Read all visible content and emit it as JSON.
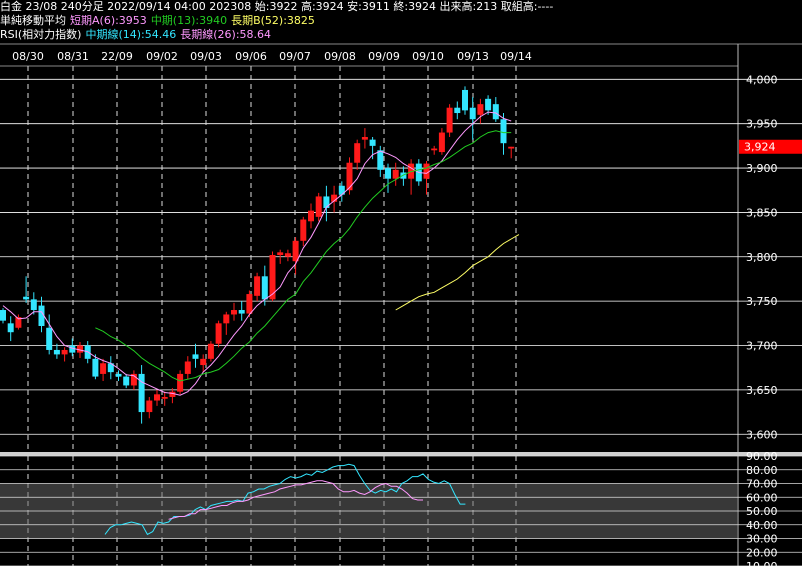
{
  "header": {
    "line1": "白金 23/08 240分足 2022/09/14 04:00 202308 始:3922 高:3924 安:3911 終:3924 出来高:213 取組高:----",
    "line2": {
      "label": "単純移動平均",
      "short": "短期A(6):3953",
      "mid": "中期(13):3940",
      "long": "長期B(52):3825"
    },
    "line3": {
      "label": "RSI(相対力指数)",
      "mid": "中期線(14):54.46",
      "long": "長期線(26):58.64"
    }
  },
  "colors": {
    "up": "#ff1a1a",
    "down": "#33e6ff",
    "ma_short": "#ff99ff",
    "ma_mid": "#22cc22",
    "ma_long": "#ffff66",
    "rsi_mid": "#33e6ff",
    "rsi_long": "#ff99ff",
    "grid": "#ffffff",
    "price_tag_bg": "#ff0000"
  },
  "last_price_label": "3,924",
  "chart_data": {
    "type": "candlestick",
    "date_labels": [
      "08/30",
      "08/31",
      "22/09",
      "09/02",
      "09/03",
      "09/06",
      "09/07",
      "09/08",
      "09/09",
      "09/10",
      "09/13",
      "09/14"
    ],
    "price_axis": {
      "ticks": [
        "4,000",
        "3,950",
        "3,900",
        "3,850",
        "3,800",
        "3,750",
        "3,700",
        "3,650",
        "3,600"
      ],
      "range": [
        3580,
        4015
      ]
    },
    "rsi_axis": {
      "ticks": [
        "90.00",
        "80.00",
        "70.00",
        "60.00",
        "50.00",
        "40.00",
        "30.00",
        "20.00",
        "10.00"
      ],
      "range": [
        10,
        90
      ]
    },
    "candles": [
      [
        3740,
        3742,
        3725,
        3728
      ],
      [
        3725,
        3733,
        3705,
        3715
      ],
      [
        3720,
        3735,
        3718,
        3732
      ],
      [
        3755,
        3778,
        3748,
        3752
      ],
      [
        3752,
        3760,
        3735,
        3740
      ],
      [
        3745,
        3755,
        3715,
        3722
      ],
      [
        3720,
        3735,
        3690,
        3695
      ],
      [
        3695,
        3702,
        3685,
        3690
      ],
      [
        3690,
        3698,
        3682,
        3695
      ],
      [
        3700,
        3708,
        3688,
        3692
      ],
      [
        3692,
        3704,
        3686,
        3700
      ],
      [
        3700,
        3705,
        3680,
        3685
      ],
      [
        3685,
        3690,
        3662,
        3665
      ],
      [
        3668,
        3685,
        3660,
        3680
      ],
      [
        3680,
        3688,
        3662,
        3670
      ],
      [
        3668,
        3672,
        3660,
        3665
      ],
      [
        3665,
        3668,
        3652,
        3655
      ],
      [
        3655,
        3672,
        3650,
        3668
      ],
      [
        3668,
        3678,
        3612,
        3625
      ],
      [
        3625,
        3642,
        3618,
        3638
      ],
      [
        3638,
        3650,
        3632,
        3645
      ],
      [
        3640,
        3648,
        3632,
        3642
      ],
      [
        3642,
        3652,
        3635,
        3648
      ],
      [
        3648,
        3672,
        3645,
        3668
      ],
      [
        3668,
        3688,
        3662,
        3682
      ],
      [
        3690,
        3702,
        3675,
        3685
      ],
      [
        3678,
        3690,
        3670,
        3685
      ],
      [
        3685,
        3705,
        3682,
        3702
      ],
      [
        3702,
        3728,
        3698,
        3725
      ],
      [
        3725,
        3738,
        3712,
        3735
      ],
      [
        3735,
        3748,
        3728,
        3740
      ],
      [
        3740,
        3750,
        3728,
        3736
      ],
      [
        3736,
        3762,
        3732,
        3758
      ],
      [
        3756,
        3782,
        3750,
        3778
      ],
      [
        3778,
        3790,
        3745,
        3752
      ],
      [
        3752,
        3806,
        3750,
        3802
      ],
      [
        3802,
        3808,
        3792,
        3805
      ],
      [
        3800,
        3808,
        3795,
        3804
      ],
      [
        3795,
        3822,
        3780,
        3818
      ],
      [
        3818,
        3845,
        3812,
        3842
      ],
      [
        3840,
        3860,
        3832,
        3852
      ],
      [
        3845,
        3872,
        3840,
        3868
      ],
      [
        3868,
        3880,
        3840,
        3855
      ],
      [
        3862,
        3880,
        3850,
        3870
      ],
      [
        3880,
        3885,
        3862,
        3870
      ],
      [
        3875,
        3912,
        3870,
        3906
      ],
      [
        3906,
        3932,
        3898,
        3928
      ],
      [
        3932,
        3945,
        3922,
        3935
      ],
      [
        3932,
        3935,
        3910,
        3925
      ],
      [
        3920,
        3925,
        3890,
        3898
      ],
      [
        3900,
        3905,
        3872,
        3888
      ],
      [
        3888,
        3906,
        3880,
        3898
      ],
      [
        3895,
        3902,
        3880,
        3888
      ],
      [
        3888,
        3910,
        3870,
        3905
      ],
      [
        3905,
        3910,
        3880,
        3885
      ],
      [
        3888,
        3908,
        3870,
        3905
      ],
      [
        3920,
        3925,
        3915,
        3922
      ],
      [
        3918,
        3945,
        3915,
        3940
      ],
      [
        3940,
        3972,
        3935,
        3968
      ],
      [
        3968,
        3975,
        3955,
        3962
      ],
      [
        3988,
        3992,
        3960,
        3965
      ],
      [
        3968,
        3980,
        3932,
        3955
      ],
      [
        3960,
        3978,
        3950,
        3972
      ],
      [
        3978,
        3982,
        3960,
        3965
      ],
      [
        3972,
        3980,
        3952,
        3955
      ],
      [
        3955,
        3962,
        3915,
        3928
      ],
      [
        3922,
        3924,
        3911,
        3924
      ]
    ],
    "series": [
      {
        "name": "短期A(6)",
        "values": [
          3745,
          3738,
          3730,
          3731,
          3738,
          3738,
          3724,
          3710,
          3700,
          3697,
          3695,
          3693,
          3687,
          3683,
          3680,
          3674,
          3667,
          3666,
          3659,
          3655,
          3651,
          3647,
          3646,
          3644,
          3648,
          3657,
          3670,
          3678,
          3688,
          3700,
          3712,
          3722,
          3735,
          3745,
          3752,
          3758,
          3766,
          3782,
          3792,
          3810,
          3822,
          3838,
          3856,
          3863,
          3870,
          3878,
          3888,
          3905,
          3915,
          3919,
          3916,
          3912,
          3905,
          3900,
          3895,
          3894,
          3900,
          3908,
          3920,
          3932,
          3942,
          3950,
          3958,
          3963,
          3962,
          3956,
          3953
        ]
      },
      {
        "name": "中期(13)",
        "values": [
          null,
          null,
          null,
          null,
          null,
          null,
          null,
          null,
          null,
          null,
          null,
          null,
          3720,
          3716,
          3710,
          3706,
          3700,
          3694,
          3686,
          3680,
          3675,
          3670,
          3664,
          3660,
          3662,
          3664,
          3668,
          3670,
          3673,
          3680,
          3688,
          3697,
          3704,
          3714,
          3722,
          3732,
          3742,
          3752,
          3758,
          3772,
          3782,
          3794,
          3806,
          3815,
          3822,
          3832,
          3845,
          3856,
          3866,
          3874,
          3882,
          3887,
          3892,
          3896,
          3898,
          3900,
          3904,
          3907,
          3912,
          3918,
          3924,
          3928,
          3935,
          3940,
          3942,
          3940,
          3940
        ]
      },
      {
        "name": "長期B(52)",
        "values": [
          null,
          null,
          null,
          null,
          null,
          null,
          null,
          null,
          null,
          null,
          null,
          null,
          null,
          null,
          null,
          null,
          null,
          null,
          null,
          null,
          null,
          null,
          null,
          null,
          null,
          null,
          null,
          null,
          null,
          null,
          null,
          null,
          null,
          null,
          null,
          null,
          null,
          null,
          null,
          null,
          null,
          null,
          null,
          null,
          null,
          null,
          null,
          null,
          null,
          null,
          null,
          3740,
          3745,
          3750,
          3755,
          3758,
          3760,
          3765,
          3770,
          3775,
          3782,
          3790,
          3795,
          3800,
          3808,
          3815,
          3820,
          3825
        ]
      }
    ],
    "rsi_series": [
      {
        "name": "中期線(14)",
        "values": [
          null,
          null,
          null,
          null,
          null,
          null,
          null,
          null,
          null,
          null,
          null,
          null,
          null,
          null,
          33,
          38,
          40,
          40,
          41,
          42,
          41,
          40,
          33,
          35,
          42,
          41,
          42,
          46,
          46,
          46,
          47,
          51,
          53,
          51,
          54,
          55,
          56,
          57,
          57,
          58,
          57,
          63,
          64,
          66,
          66,
          68,
          69,
          70,
          73,
          75,
          74,
          75,
          77,
          76,
          79,
          78,
          80,
          82,
          83,
          83,
          84,
          83,
          76,
          70,
          65,
          63,
          65,
          64,
          66,
          64,
          70,
          72,
          75,
          75,
          77,
          73,
          71,
          70,
          72,
          70,
          62,
          55,
          55
        ]
      },
      {
        "name": "長期線(26)",
        "values": [
          null,
          null,
          null,
          null,
          null,
          null,
          null,
          null,
          null,
          null,
          null,
          null,
          null,
          null,
          null,
          null,
          null,
          null,
          null,
          null,
          null,
          null,
          null,
          null,
          null,
          null,
          44,
          45,
          46,
          46,
          48,
          48,
          51,
          51,
          52,
          53,
          54,
          54,
          56,
          57,
          57,
          58,
          60,
          61,
          62,
          63,
          64,
          66,
          67,
          68,
          69,
          69,
          70,
          71,
          72,
          72,
          71,
          70,
          66,
          64,
          64,
          65,
          63,
          62,
          64,
          67,
          69,
          70,
          68,
          68,
          66,
          63,
          59,
          58,
          58
        ]
      }
    ]
  }
}
